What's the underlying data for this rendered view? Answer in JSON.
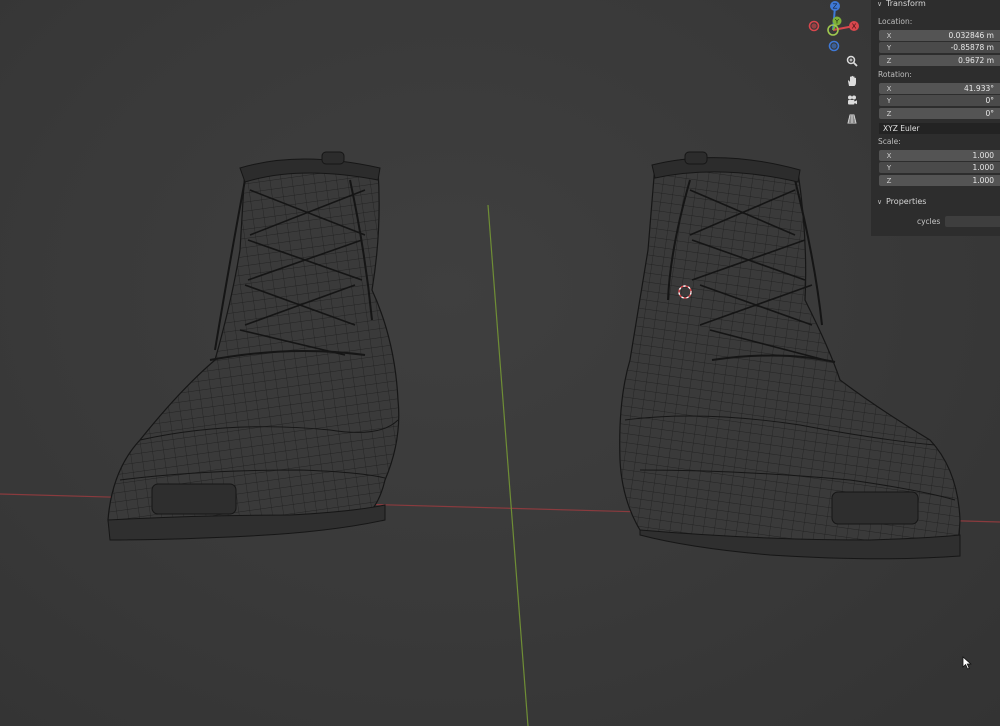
{
  "transform": {
    "title": "Transform",
    "location_label": "Location:",
    "location": [
      {
        "axis": "X",
        "value": "0.032846 m"
      },
      {
        "axis": "Y",
        "value": "-0.85878 m"
      },
      {
        "axis": "Z",
        "value": "0.9672 m"
      }
    ],
    "rotation_label": "Rotation:",
    "rotation": [
      {
        "axis": "X",
        "value": "41.933°"
      },
      {
        "axis": "Y",
        "value": "0°"
      },
      {
        "axis": "Z",
        "value": "0°"
      }
    ],
    "rotation_mode": "XYZ Euler",
    "scale_label": "Scale:",
    "scale": [
      {
        "axis": "X",
        "value": "1.000"
      },
      {
        "axis": "Y",
        "value": "1.000"
      },
      {
        "axis": "Z",
        "value": "1.000"
      }
    ]
  },
  "properties": {
    "title": "Properties",
    "cycles_label": "cycles"
  },
  "gizmo": {
    "z": "Z",
    "y": "Y",
    "x": "X"
  },
  "nav_icons": [
    "zoom-icon",
    "hand-pan-icon",
    "camera-icon",
    "grid-ortho-icon"
  ],
  "colors": {
    "x_axis": "#d8474d",
    "y_axis": "#7fb23a",
    "z_axis": "#3f79d6",
    "wire": "#1a1a1a",
    "panel_bg": "#2d2d2d",
    "field_bg": "#545454"
  }
}
